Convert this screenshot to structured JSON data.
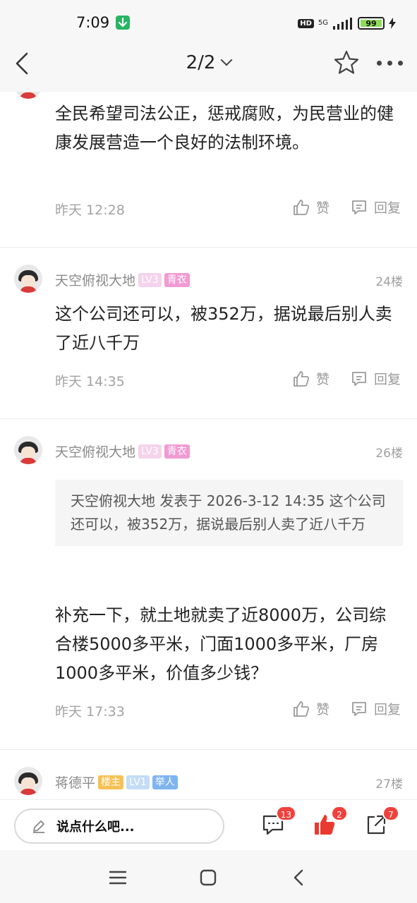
{
  "status_bar": {
    "time": "7:09",
    "hd": "HD",
    "network": "5G",
    "battery": "99"
  },
  "header": {
    "page_indicator": "2/2"
  },
  "posts": [
    {
      "text": "全民希望司法公正，惩戒腐败，为民营业的健康发展营造一个良好的法制环境。",
      "time": "昨天 12:28",
      "like_label": "赞",
      "reply_label": "回复"
    },
    {
      "username": "天空俯视大地",
      "level": "LV3",
      "role": "青衣",
      "floor": "24楼",
      "text": "这个公司还可以，被352万，据说最后别人卖了近八千万",
      "time": "昨天 14:35",
      "like_label": "赞",
      "reply_label": "回复"
    },
    {
      "username": "天空俯视大地",
      "level": "LV3",
      "role": "青衣",
      "floor": "26楼",
      "quote": "天空俯视大地 发表于 2026-3-12 14:35 这个公司还可以，被352万，据说最后别人卖了近八千万",
      "text": "补充一下，就土地就卖了近8000万，公司综合楼5000多平米，门面1000多平米，厂房1000多平米，价值多少钱？",
      "time": "昨天 17:33",
      "like_label": "赞",
      "reply_label": "回复"
    },
    {
      "username": "蒋德平",
      "owner": "楼主",
      "level": "LV1",
      "role": "举人",
      "floor": "27楼"
    }
  ],
  "input_bar": {
    "placeholder": "说点什么吧...",
    "comments_count": "13",
    "likes_count": "2",
    "shares_count": "7"
  },
  "colors": {
    "badge": "#f0413c",
    "like_active": "#e83a30"
  }
}
